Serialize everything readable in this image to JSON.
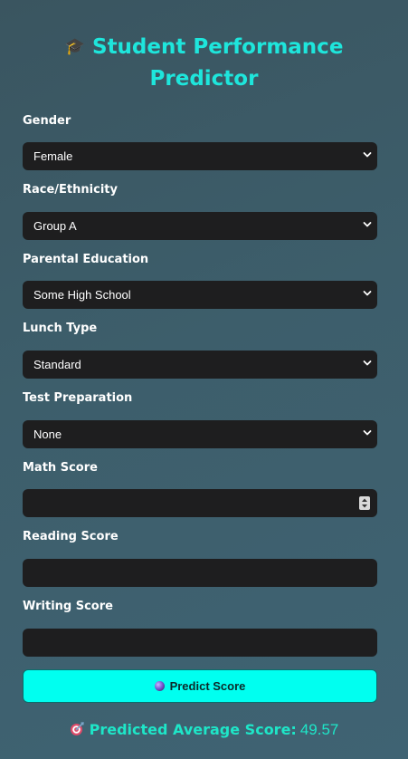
{
  "header": {
    "icon": "graduation-cap-icon",
    "title_line1": "Student Performance",
    "title_line2": "Predictor"
  },
  "form": {
    "gender": {
      "label": "Gender",
      "value": "Female"
    },
    "race": {
      "label": "Race/Ethnicity",
      "value": "Group A"
    },
    "parental_education": {
      "label": "Parental Education",
      "value": "Some High School"
    },
    "lunch": {
      "label": "Lunch Type",
      "value": "Standard"
    },
    "test_prep": {
      "label": "Test Preparation",
      "value": "None"
    },
    "math": {
      "label": "Math Score",
      "value": ""
    },
    "reading": {
      "label": "Reading Score",
      "value": ""
    },
    "writing": {
      "label": "Writing Score",
      "value": ""
    }
  },
  "predict_button": {
    "icon": "crystal-ball-icon",
    "label": "Predict Score"
  },
  "result": {
    "icon": "target-icon",
    "label": "Predicted Average Score:",
    "value": "49.57"
  },
  "colors": {
    "accent": "#1ee6dc",
    "button_bg": "#00fff0",
    "field_bg": "#1e1e1f",
    "page_bg": "#3d5e6b"
  }
}
